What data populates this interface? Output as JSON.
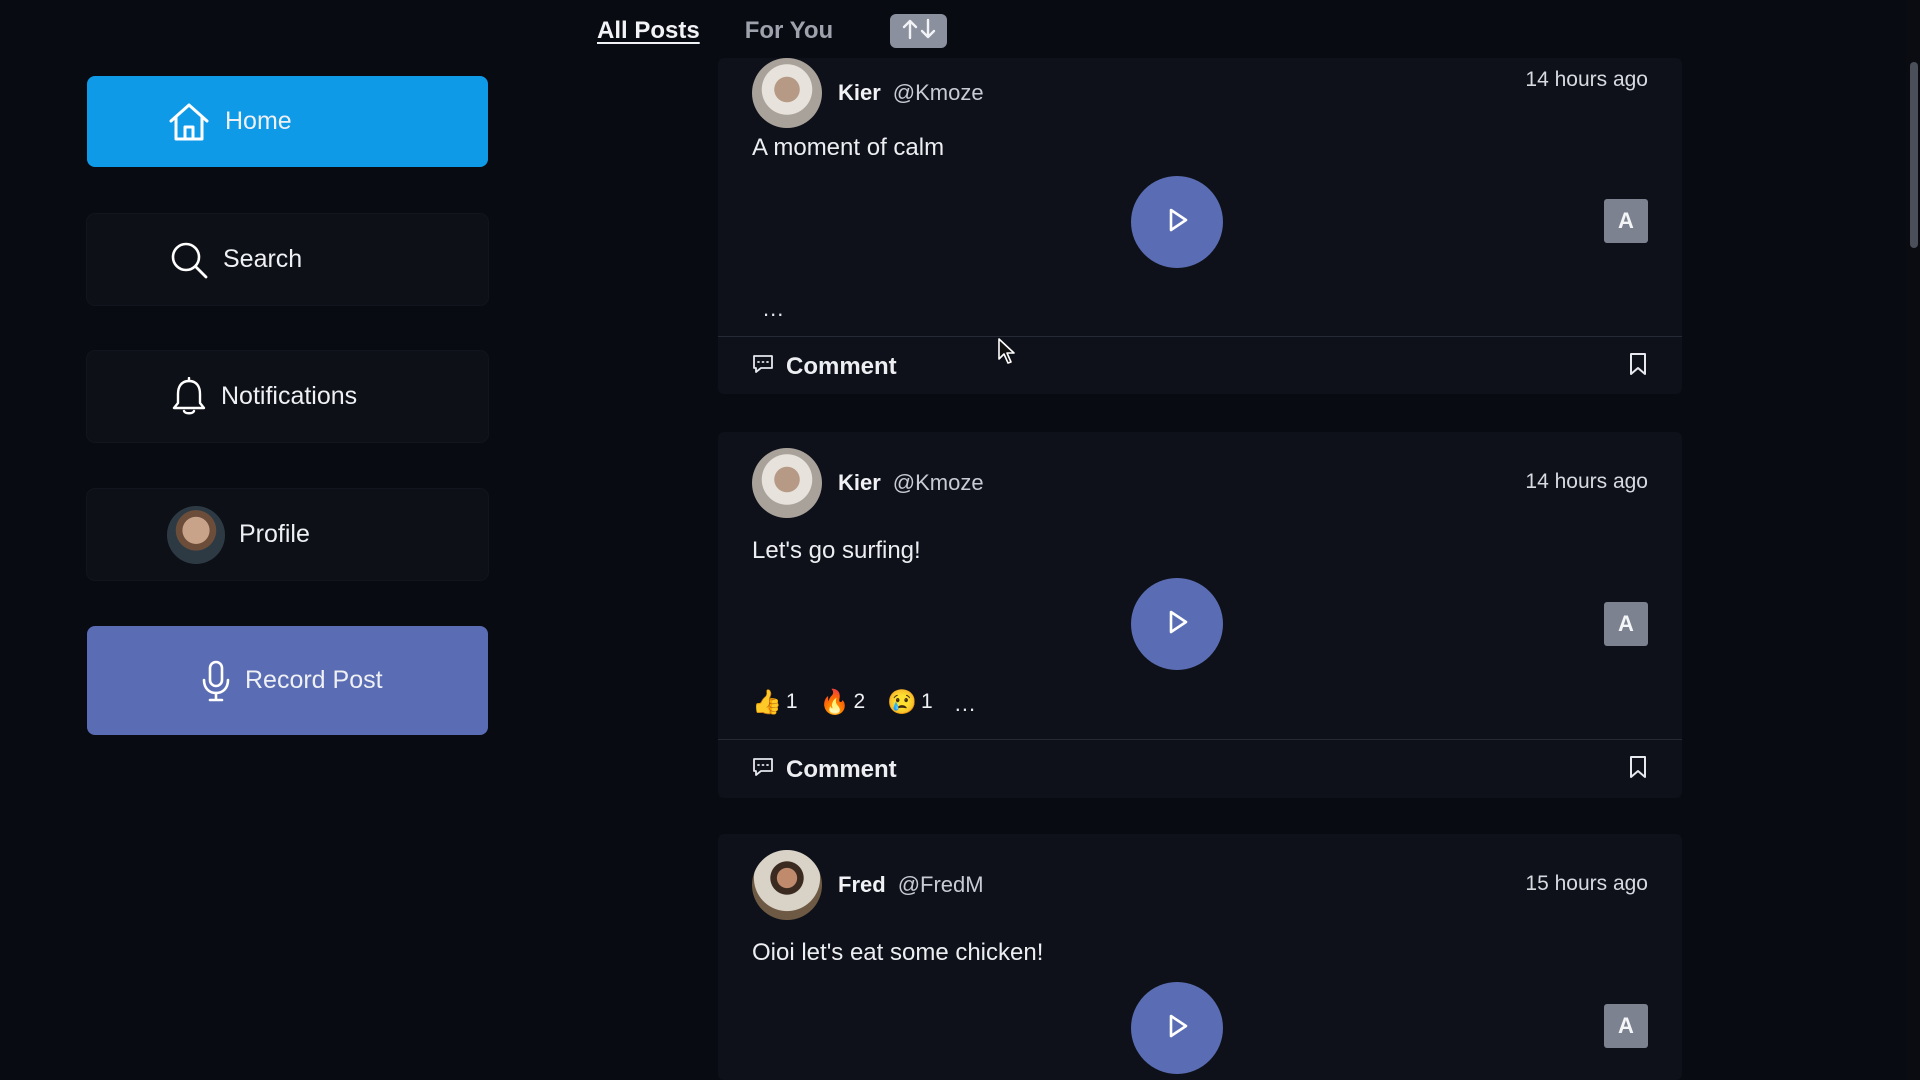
{
  "tabs": {
    "all_posts": "All Posts",
    "for_you": "For You"
  },
  "sidebar": {
    "home": "Home",
    "search": "Search",
    "notifications": "Notifications",
    "profile": "Profile",
    "record_post": "Record Post"
  },
  "posts": [
    {
      "name": "Kier",
      "handle": "@Kmoze",
      "time": "14 hours ago",
      "text": "A moment of calm",
      "a_label": "A",
      "more": "...",
      "comment_label": "Comment"
    },
    {
      "name": "Kier",
      "handle": "@Kmoze",
      "time": "14 hours ago",
      "text": "Let's go surfing!",
      "a_label": "A",
      "more": "...",
      "reactions": [
        {
          "emoji": "👍",
          "count": "1"
        },
        {
          "emoji": "🔥",
          "count": "2"
        },
        {
          "emoji": "😢",
          "count": "1"
        }
      ],
      "comment_label": "Comment"
    },
    {
      "name": "Fred",
      "handle": "@FredM",
      "time": "15 hours ago",
      "text": "Oioi let's eat some chicken!",
      "a_label": "A"
    }
  ],
  "colors": {
    "background": "#090b12",
    "card": "#0e1119",
    "home_active": "#0f9ae8",
    "accent": "#5a6cb3",
    "a_button": "#7c8290"
  },
  "icons": [
    "home-icon",
    "search-icon",
    "bell-icon",
    "microphone-icon",
    "sort-arrows-icon",
    "play-icon",
    "comment-icon",
    "bookmark-icon"
  ]
}
